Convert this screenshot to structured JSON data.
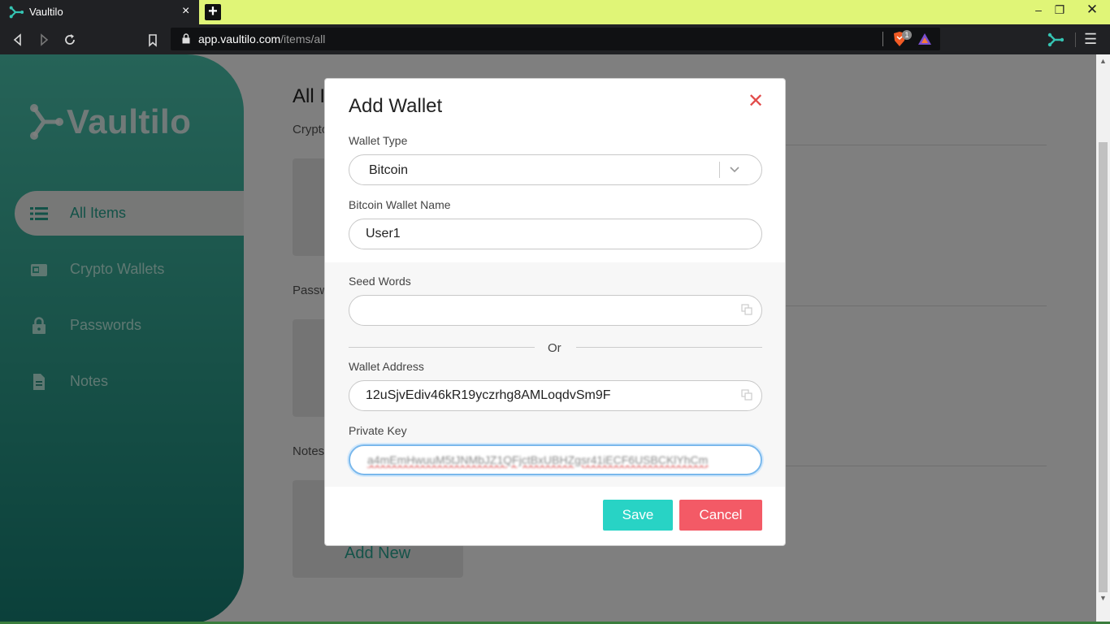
{
  "browser": {
    "tab_title": "Vaultilo",
    "tab_close": "×",
    "new_tab": "+",
    "url_host": "app.vaultilo.com",
    "url_path": "/items/all",
    "brave_badge": "1",
    "window_minimize": "–",
    "window_restore": "❐",
    "window_close": "✕",
    "menu": "☰"
  },
  "app": {
    "logo_text": "Vaultilo",
    "brand_color": "#2fa18f",
    "sidebar": {
      "items": [
        {
          "label": "All Items",
          "icon": "list-icon",
          "active": true
        },
        {
          "label": "Crypto Wallets",
          "icon": "wallet-icon",
          "active": false
        },
        {
          "label": "Passwords",
          "icon": "lock-icon",
          "active": false
        },
        {
          "label": "Notes",
          "icon": "note-icon",
          "active": false
        }
      ]
    },
    "main": {
      "title": "All I",
      "sections": [
        "Crypto",
        "Passw",
        "Notes"
      ],
      "add_new": "Add New"
    }
  },
  "modal": {
    "title": "Add Wallet",
    "close": "✕",
    "wallet_type_label": "Wallet Type",
    "wallet_type_value": "Bitcoin",
    "wallet_name_label": "Bitcoin Wallet Name",
    "wallet_name_value": "User1",
    "seed_words_label": "Seed Words",
    "seed_words_value": "",
    "or_text": "Or",
    "wallet_address_label": "Wallet Address",
    "wallet_address_value": "12uSjvEdiv46kR19yczrhg8AMLoqdvSm9F",
    "private_key_label": "Private Key",
    "private_key_value": "a4mEmHwuuM5tJNMbJZ1QFjctBxUBHZgsr41iECF6USBCKlYhCm",
    "save_label": "Save",
    "cancel_label": "Cancel",
    "colors": {
      "save": "#28d3c5",
      "cancel": "#f35a66",
      "close": "#e24c4b"
    }
  }
}
